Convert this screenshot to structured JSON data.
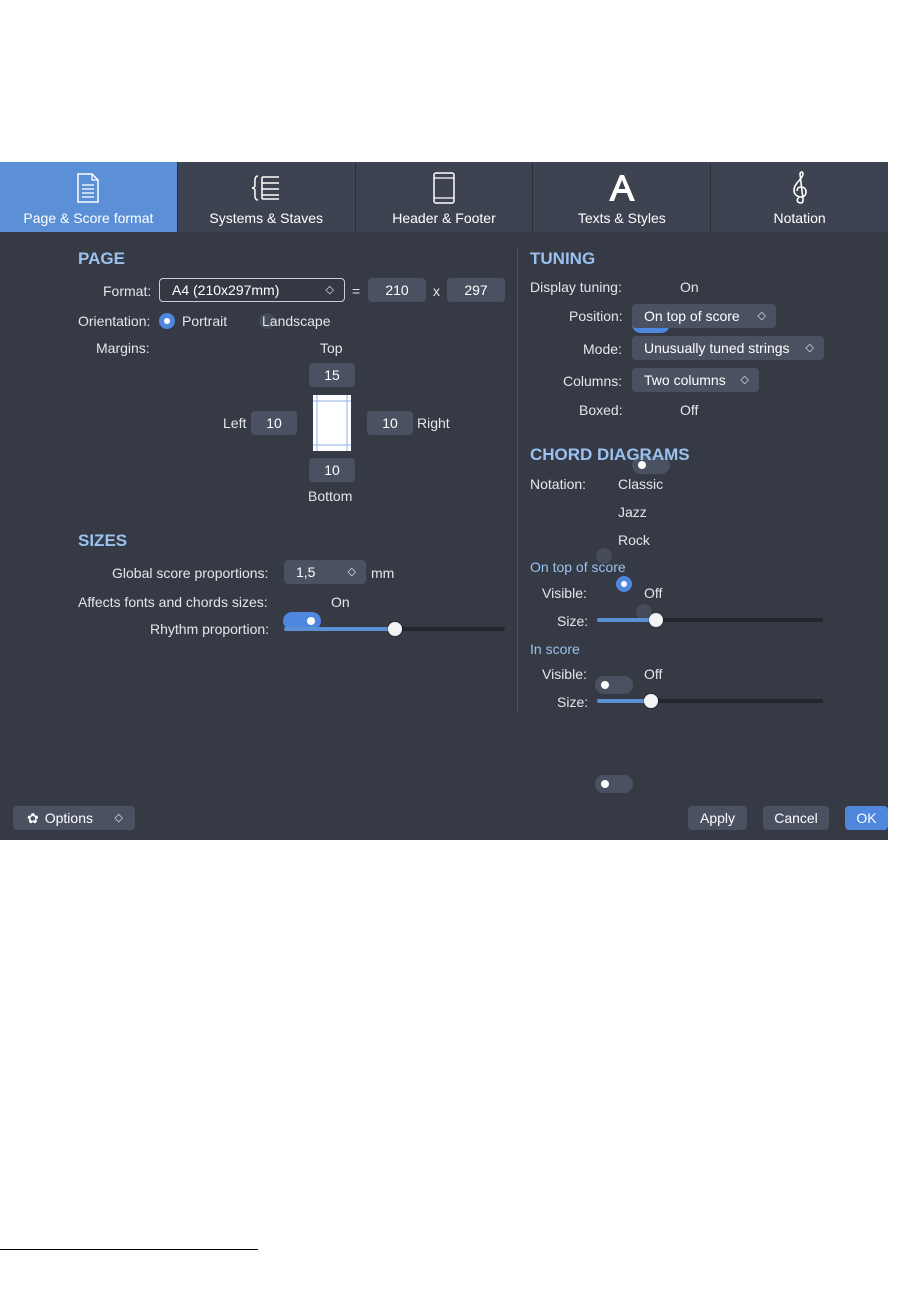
{
  "tabs": [
    {
      "label": "Page & Score format",
      "icon": "page-icon",
      "active": true
    },
    {
      "label": "Systems & Staves",
      "icon": "systems-staves-icon",
      "active": false
    },
    {
      "label": "Header & Footer",
      "icon": "header-footer-icon",
      "active": false
    },
    {
      "label": "Texts & Styles",
      "icon": "text-styles-icon",
      "active": false
    },
    {
      "label": "Notation",
      "icon": "treble-clef-icon",
      "active": false
    }
  ],
  "page": {
    "title": "PAGE",
    "format_label": "Format:",
    "format_value": "A4 (210x297mm)",
    "equals": "=",
    "width": "210",
    "times": "x",
    "height": "297",
    "orientation_label": "Orientation:",
    "portrait": "Portrait",
    "landscape": "Landscape",
    "orientation_selected": "Portrait",
    "margins_label": "Margins:",
    "top_label": "Top",
    "top": "15",
    "left_label": "Left",
    "left": "10",
    "right": "10",
    "right_label": "Right",
    "bottom": "10",
    "bottom_label": "Bottom"
  },
  "sizes": {
    "title": "SIZES",
    "global_label": "Global score proportions:",
    "global_value": "1,5",
    "global_unit": "mm",
    "affects_label": "Affects fonts and chords sizes:",
    "affects_state": "On",
    "affects_on": true,
    "rhythm_label": "Rhythm proportion:",
    "rhythm_value": 0.5
  },
  "tuning": {
    "title": "TUNING",
    "display_label": "Display tuning:",
    "display_state": "On",
    "display_on": true,
    "position_label": "Position:",
    "position_value": "On top of score",
    "mode_label": "Mode:",
    "mode_value": "Unusually tuned strings",
    "columns_label": "Columns:",
    "columns_value": "Two columns",
    "boxed_label": "Boxed:",
    "boxed_state": "Off",
    "boxed_on": false
  },
  "chord_diagrams": {
    "title": "CHORD DIAGRAMS",
    "notation_label": "Notation:",
    "options": [
      "Classic",
      "Jazz",
      "Rock"
    ],
    "selected": "Jazz",
    "on_top_title": "On top of score",
    "on_top_visible_label": "Visible:",
    "on_top_visible_state": "Off",
    "on_top_size_label": "Size:",
    "on_top_size_value": 0.26,
    "in_score_title": "In score",
    "in_score_visible_label": "Visible:",
    "in_score_visible_state": "Off",
    "in_score_size_label": "Size:",
    "in_score_size_value": 0.24
  },
  "footer": {
    "options_label": "Options",
    "apply": "Apply",
    "cancel": "Cancel",
    "ok": "OK"
  },
  "colors": {
    "background": "#353a44",
    "tab_bar": "#3d4350",
    "accent": "#4f86de",
    "heading": "#9ac1ef"
  }
}
